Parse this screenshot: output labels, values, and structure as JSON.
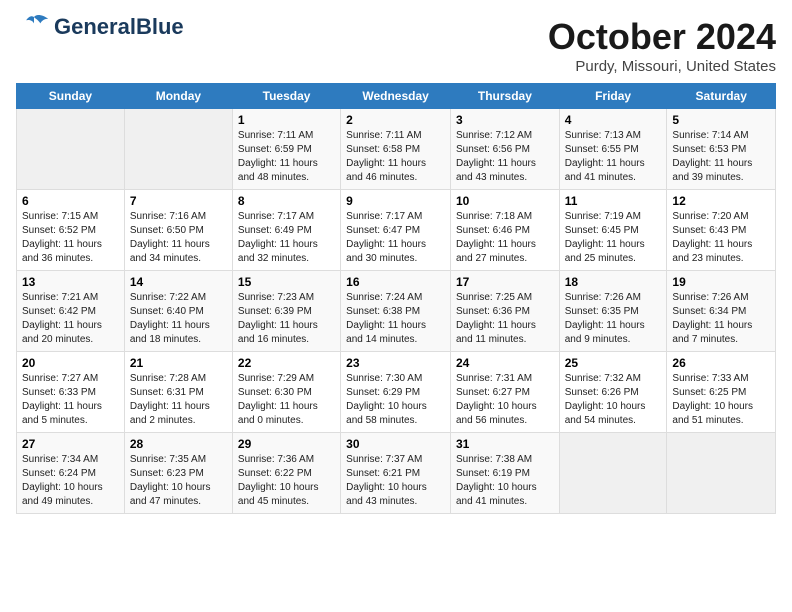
{
  "logo": {
    "general": "General",
    "blue": "Blue"
  },
  "title": "October 2024",
  "subtitle": "Purdy, Missouri, United States",
  "days_of_week": [
    "Sunday",
    "Monday",
    "Tuesday",
    "Wednesday",
    "Thursday",
    "Friday",
    "Saturday"
  ],
  "weeks": [
    [
      {
        "day": "",
        "info": ""
      },
      {
        "day": "",
        "info": ""
      },
      {
        "day": "1",
        "info": "Sunrise: 7:11 AM\nSunset: 6:59 PM\nDaylight: 11 hours and 48 minutes."
      },
      {
        "day": "2",
        "info": "Sunrise: 7:11 AM\nSunset: 6:58 PM\nDaylight: 11 hours and 46 minutes."
      },
      {
        "day": "3",
        "info": "Sunrise: 7:12 AM\nSunset: 6:56 PM\nDaylight: 11 hours and 43 minutes."
      },
      {
        "day": "4",
        "info": "Sunrise: 7:13 AM\nSunset: 6:55 PM\nDaylight: 11 hours and 41 minutes."
      },
      {
        "day": "5",
        "info": "Sunrise: 7:14 AM\nSunset: 6:53 PM\nDaylight: 11 hours and 39 minutes."
      }
    ],
    [
      {
        "day": "6",
        "info": "Sunrise: 7:15 AM\nSunset: 6:52 PM\nDaylight: 11 hours and 36 minutes."
      },
      {
        "day": "7",
        "info": "Sunrise: 7:16 AM\nSunset: 6:50 PM\nDaylight: 11 hours and 34 minutes."
      },
      {
        "day": "8",
        "info": "Sunrise: 7:17 AM\nSunset: 6:49 PM\nDaylight: 11 hours and 32 minutes."
      },
      {
        "day": "9",
        "info": "Sunrise: 7:17 AM\nSunset: 6:47 PM\nDaylight: 11 hours and 30 minutes."
      },
      {
        "day": "10",
        "info": "Sunrise: 7:18 AM\nSunset: 6:46 PM\nDaylight: 11 hours and 27 minutes."
      },
      {
        "day": "11",
        "info": "Sunrise: 7:19 AM\nSunset: 6:45 PM\nDaylight: 11 hours and 25 minutes."
      },
      {
        "day": "12",
        "info": "Sunrise: 7:20 AM\nSunset: 6:43 PM\nDaylight: 11 hours and 23 minutes."
      }
    ],
    [
      {
        "day": "13",
        "info": "Sunrise: 7:21 AM\nSunset: 6:42 PM\nDaylight: 11 hours and 20 minutes."
      },
      {
        "day": "14",
        "info": "Sunrise: 7:22 AM\nSunset: 6:40 PM\nDaylight: 11 hours and 18 minutes."
      },
      {
        "day": "15",
        "info": "Sunrise: 7:23 AM\nSunset: 6:39 PM\nDaylight: 11 hours and 16 minutes."
      },
      {
        "day": "16",
        "info": "Sunrise: 7:24 AM\nSunset: 6:38 PM\nDaylight: 11 hours and 14 minutes."
      },
      {
        "day": "17",
        "info": "Sunrise: 7:25 AM\nSunset: 6:36 PM\nDaylight: 11 hours and 11 minutes."
      },
      {
        "day": "18",
        "info": "Sunrise: 7:26 AM\nSunset: 6:35 PM\nDaylight: 11 hours and 9 minutes."
      },
      {
        "day": "19",
        "info": "Sunrise: 7:26 AM\nSunset: 6:34 PM\nDaylight: 11 hours and 7 minutes."
      }
    ],
    [
      {
        "day": "20",
        "info": "Sunrise: 7:27 AM\nSunset: 6:33 PM\nDaylight: 11 hours and 5 minutes."
      },
      {
        "day": "21",
        "info": "Sunrise: 7:28 AM\nSunset: 6:31 PM\nDaylight: 11 hours and 2 minutes."
      },
      {
        "day": "22",
        "info": "Sunrise: 7:29 AM\nSunset: 6:30 PM\nDaylight: 11 hours and 0 minutes."
      },
      {
        "day": "23",
        "info": "Sunrise: 7:30 AM\nSunset: 6:29 PM\nDaylight: 10 hours and 58 minutes."
      },
      {
        "day": "24",
        "info": "Sunrise: 7:31 AM\nSunset: 6:27 PM\nDaylight: 10 hours and 56 minutes."
      },
      {
        "day": "25",
        "info": "Sunrise: 7:32 AM\nSunset: 6:26 PM\nDaylight: 10 hours and 54 minutes."
      },
      {
        "day": "26",
        "info": "Sunrise: 7:33 AM\nSunset: 6:25 PM\nDaylight: 10 hours and 51 minutes."
      }
    ],
    [
      {
        "day": "27",
        "info": "Sunrise: 7:34 AM\nSunset: 6:24 PM\nDaylight: 10 hours and 49 minutes."
      },
      {
        "day": "28",
        "info": "Sunrise: 7:35 AM\nSunset: 6:23 PM\nDaylight: 10 hours and 47 minutes."
      },
      {
        "day": "29",
        "info": "Sunrise: 7:36 AM\nSunset: 6:22 PM\nDaylight: 10 hours and 45 minutes."
      },
      {
        "day": "30",
        "info": "Sunrise: 7:37 AM\nSunset: 6:21 PM\nDaylight: 10 hours and 43 minutes."
      },
      {
        "day": "31",
        "info": "Sunrise: 7:38 AM\nSunset: 6:19 PM\nDaylight: 10 hours and 41 minutes."
      },
      {
        "day": "",
        "info": ""
      },
      {
        "day": "",
        "info": ""
      }
    ]
  ]
}
